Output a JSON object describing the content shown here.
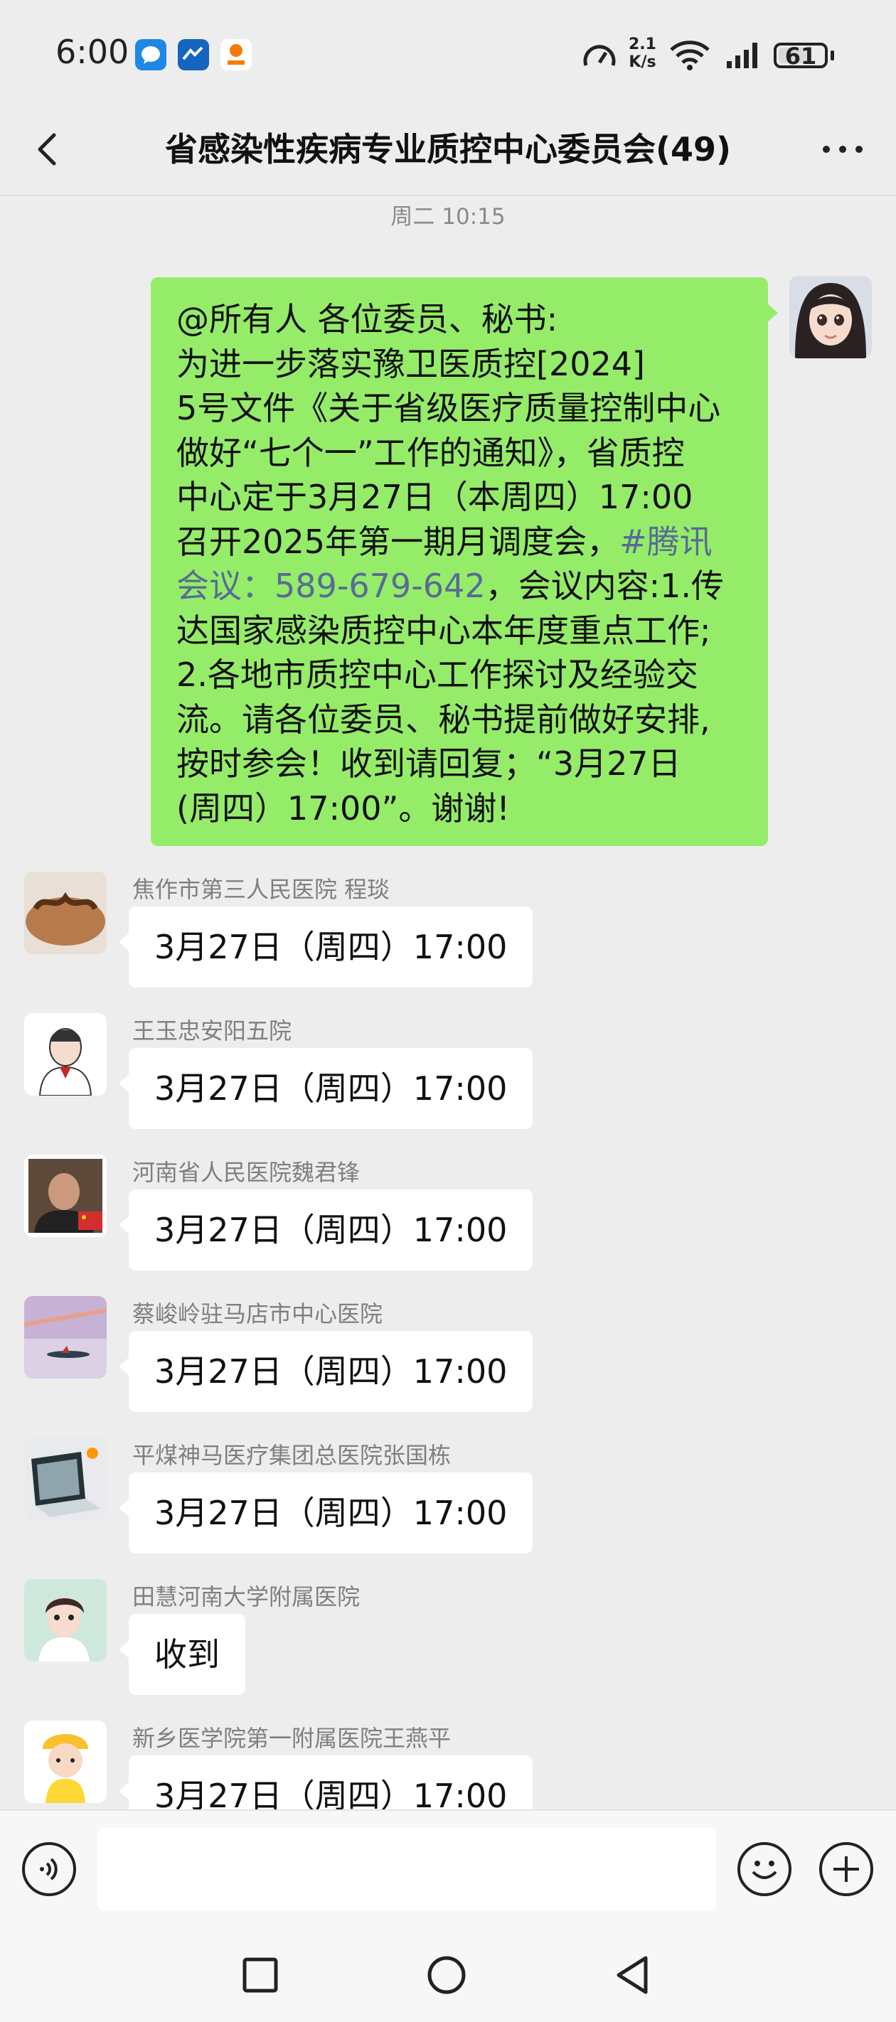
{
  "status_bar": {
    "time": "6:00",
    "net_speed_top": "2.1",
    "net_speed_unit": "K/s",
    "battery": "61",
    "icons": [
      "chat-app-icon",
      "messenger-app-icon",
      "xiaohongshu-app-icon",
      "speed-gauge-icon",
      "wifi-icon",
      "signal-icon",
      "battery-icon"
    ]
  },
  "header": {
    "title": "省感染性疾病专业质控中心委员会(49)"
  },
  "timestamp": "周二 10:15",
  "my_message": {
    "lines": [
      {
        "text": "@所有人  各位委员、秘书:"
      },
      {
        "text": "        为进一步落实豫卫医质控[2024]"
      },
      {
        "text": "5号文件《关于省级医疗质量控制中心"
      },
      {
        "text": "做好“七个一”工作的通知》，省质控"
      },
      {
        "text": "中心定于3月27日（本周四）17:00"
      },
      {
        "text": "召开2025年第一期月调度会，",
        "link": "#腾讯"
      },
      {
        "text": "",
        "link": "会议：589-679-642",
        "after": "，会议内容:1.传"
      },
      {
        "text": "达国家感染质控中心本年度重点工作;"
      },
      {
        "text": "2.各地市质控中心工作探讨及经验交"
      },
      {
        "text": "流。请各位委员、秘书提前做好安排,"
      },
      {
        "text": "按时参会！收到请回复；“3月27日"
      },
      {
        "text": "(周四）17:00”。谢谢!"
      }
    ]
  },
  "messages": [
    {
      "sender": "焦作市第三人民医院 程琰",
      "text": "3月27日（周四）17:00"
    },
    {
      "sender": "王玉忠安阳五院",
      "text": "3月27日（周四）17:00"
    },
    {
      "sender": "河南省人民医院魏君锋",
      "text": "3月27日（周四）17:00"
    },
    {
      "sender": "蔡峻岭驻马店市中心医院",
      "text": "3月27日（周四）17:00"
    },
    {
      "sender": "平煤神马医疗集团总医院张国栋",
      "text": "3月27日（周四）17:00"
    },
    {
      "sender": "田慧河南大学附属医院",
      "text": "收到"
    },
    {
      "sender": "新乡医学院第一附属医院王燕平",
      "text": "3月27日（周四）17:00"
    }
  ],
  "input_bar": {
    "placeholder": ""
  },
  "colors": {
    "background": "#ededed",
    "my_bubble": "#95ec69",
    "their_bubble": "#ffffff",
    "link": "#576b95"
  }
}
